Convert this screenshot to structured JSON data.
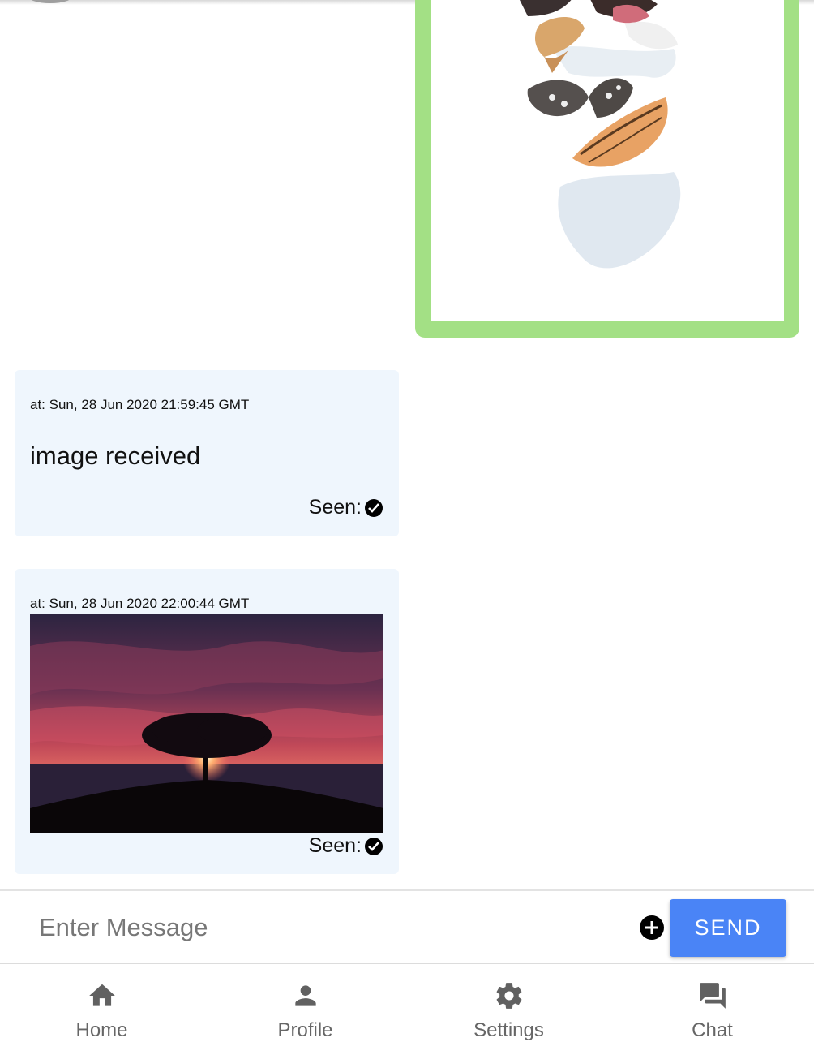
{
  "messages": [
    {
      "timestamp": "at: Sun, 28 Jun 2020 21:59:45 GMT",
      "text": "image received",
      "seen_label": "Seen:"
    },
    {
      "timestamp": "at: Sun, 28 Jun 2020 22:00:44 GMT",
      "image": "sunset-tree-photo",
      "seen_label": "Seen:"
    }
  ],
  "composer": {
    "placeholder": "Enter Message",
    "send_label": "SEND"
  },
  "nav": {
    "items": [
      {
        "label": "Home",
        "icon": "home-icon"
      },
      {
        "label": "Profile",
        "icon": "person-icon"
      },
      {
        "label": "Settings",
        "icon": "gear-icon"
      },
      {
        "label": "Chat",
        "icon": "chat-icon"
      }
    ]
  },
  "colors": {
    "sent_frame": "#a3e085",
    "received_bubble": "#eff6fd",
    "send_button": "#4a84f6",
    "nav_icon": "#616161"
  }
}
